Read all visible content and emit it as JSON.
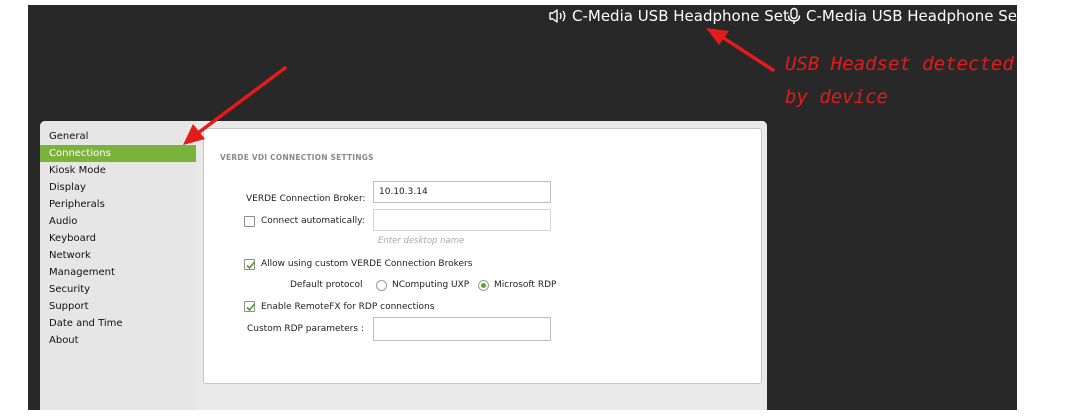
{
  "topbar": {
    "speaker_device": "C-Media USB Headphone Set",
    "mic_device": "C-Media USB Headphone Set"
  },
  "sidebar": {
    "items": [
      {
        "label": "General"
      },
      {
        "label": "Connections"
      },
      {
        "label": "Kiosk Mode"
      },
      {
        "label": "Display"
      },
      {
        "label": "Peripherals"
      },
      {
        "label": "Audio"
      },
      {
        "label": "Keyboard"
      },
      {
        "label": "Network"
      },
      {
        "label": "Management"
      },
      {
        "label": "Security"
      },
      {
        "label": "Support"
      },
      {
        "label": "Date and Time"
      },
      {
        "label": "About"
      }
    ],
    "active_index": 1
  },
  "settings": {
    "section_title": "VERDE VDI CONNECTION SETTINGS",
    "broker_label": "VERDE  Connection Broker:",
    "broker_value": "10.10.3.14",
    "connect_auto_label": "Connect automatically:",
    "connect_auto_checked": false,
    "desktop_name_value": "",
    "desktop_name_hint": "Enter desktop name",
    "allow_custom_label": "Allow using custom VERDE Connection Brokers",
    "allow_custom_checked": true,
    "protocol_label": "Default protocol",
    "protocol_options": [
      "NComputing UXP",
      "Microsoft RDP"
    ],
    "protocol_selected": "Microsoft RDP",
    "remotefx_label": "Enable RemoteFX for RDP connections",
    "remotefx_checked": true,
    "rdp_params_label": "Custom RDP parameters :",
    "rdp_params_value": ""
  },
  "annotation": {
    "line1": "USB Headset detected",
    "line2": "by device",
    "color": "#e21b1b"
  },
  "colors": {
    "accent": "#7ab33c",
    "desktop": "#282828"
  }
}
